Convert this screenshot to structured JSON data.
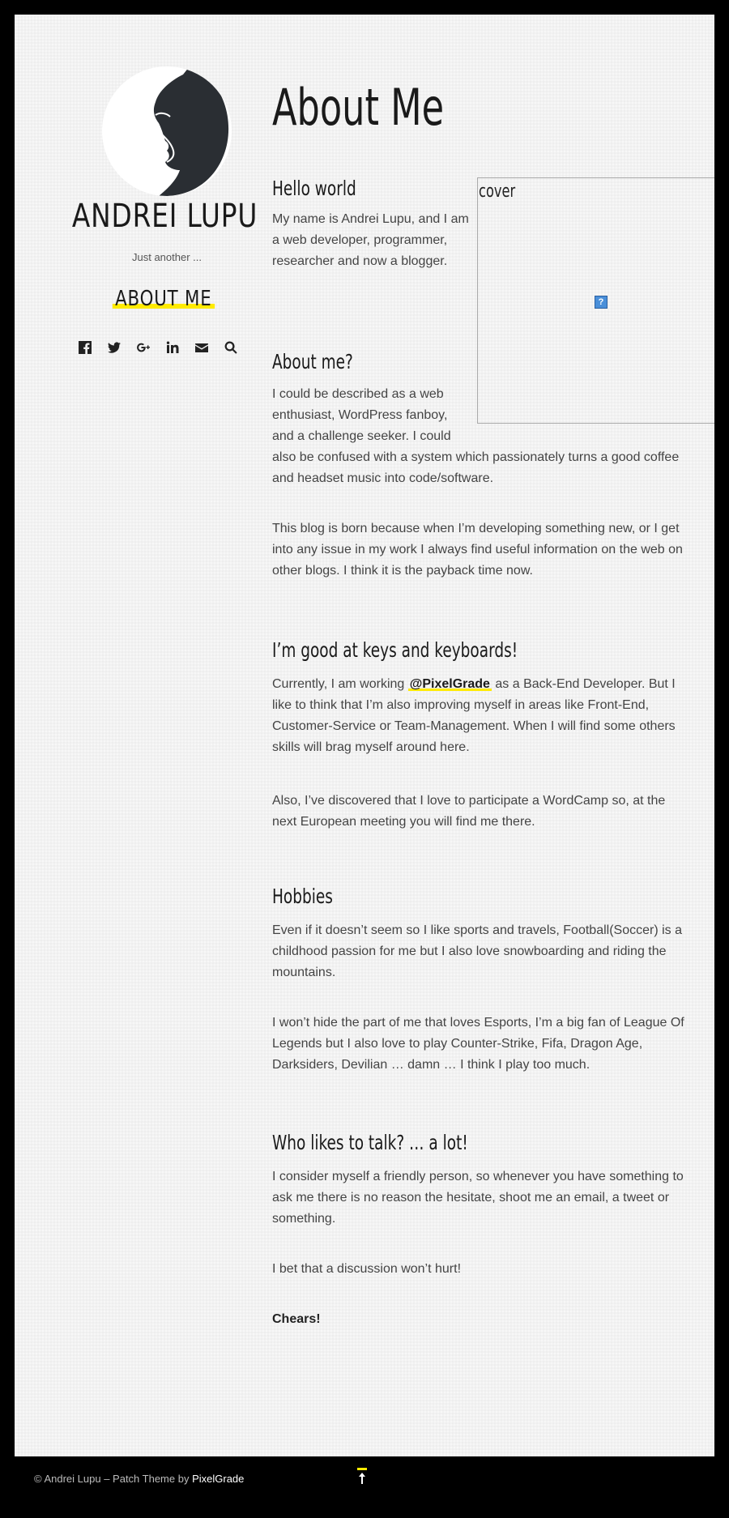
{
  "site": {
    "title": "ANDREI LUPU",
    "tagline": "Just another ..."
  },
  "nav": {
    "about_label": "ABOUT ME"
  },
  "social": [
    {
      "name": "facebook-icon"
    },
    {
      "name": "twitter-icon"
    },
    {
      "name": "google-plus-icon"
    },
    {
      "name": "linkedin-icon"
    },
    {
      "name": "email-icon"
    },
    {
      "name": "search-icon"
    }
  ],
  "page": {
    "title": "About Me",
    "cover_alt": "cover",
    "sections": [
      {
        "heading": "Hello world",
        "paragraphs": [
          "My name is Andrei Lupu, and I am a web developer, programmer, researcher and now a blogger."
        ]
      },
      {
        "heading": "About me?",
        "paragraphs": [
          "I could be described as a web enthusiast, WordPress fanboy, and a challenge seeker. I could",
          "also be confused with a system which passionately turns a good coffee and headset music into code/software.",
          "This blog is born because when I’m developing something new, or I get into any issue in my work I always find useful information on the web on other blogs. I think it is the payback time now."
        ]
      },
      {
        "heading": "I’m good at keys and keyboards!",
        "p1_before": "Currently, I am working ",
        "p1_link": "@PixelGrade",
        "p1_after": " as a Back-End Developer. But I like to think that I’m also improving myself in areas like Front-End, Customer-Service or Team-Management. When I will find some others skills will brag myself around here.",
        "p2": "Also, I’ve discovered that I love to participate a WordCamp so, at the next European meeting you will find me there."
      },
      {
        "heading": "Hobbies",
        "paragraphs": [
          "Even if it doesn’t seem so I like sports and travels, Football(Soccer) is a childhood passion for me but I also love snowboarding and riding the mountains.",
          "I won’t hide the part of me that loves Esports, I’m a big fan of League Of Legends but I also love to play Counter-Strike, Fifa, Dragon Age, Darksiders, Devilian … damn … I think I play too much."
        ]
      },
      {
        "heading": "Who likes to talk? … a lot!",
        "paragraphs": [
          "I consider myself a friendly person, so whenever you have something to ask me there is no reason the hesitate, shoot me an email, a tweet or something.",
          "I bet that a discussion won’t hurt!"
        ],
        "signoff": "Chears!"
      }
    ]
  },
  "footer": {
    "text": "© Andrei Lupu – Patch Theme by ",
    "link": "PixelGrade"
  },
  "colors": {
    "accent": "#ffeb00",
    "background": "#f7f7f7",
    "frame": "#000000"
  }
}
